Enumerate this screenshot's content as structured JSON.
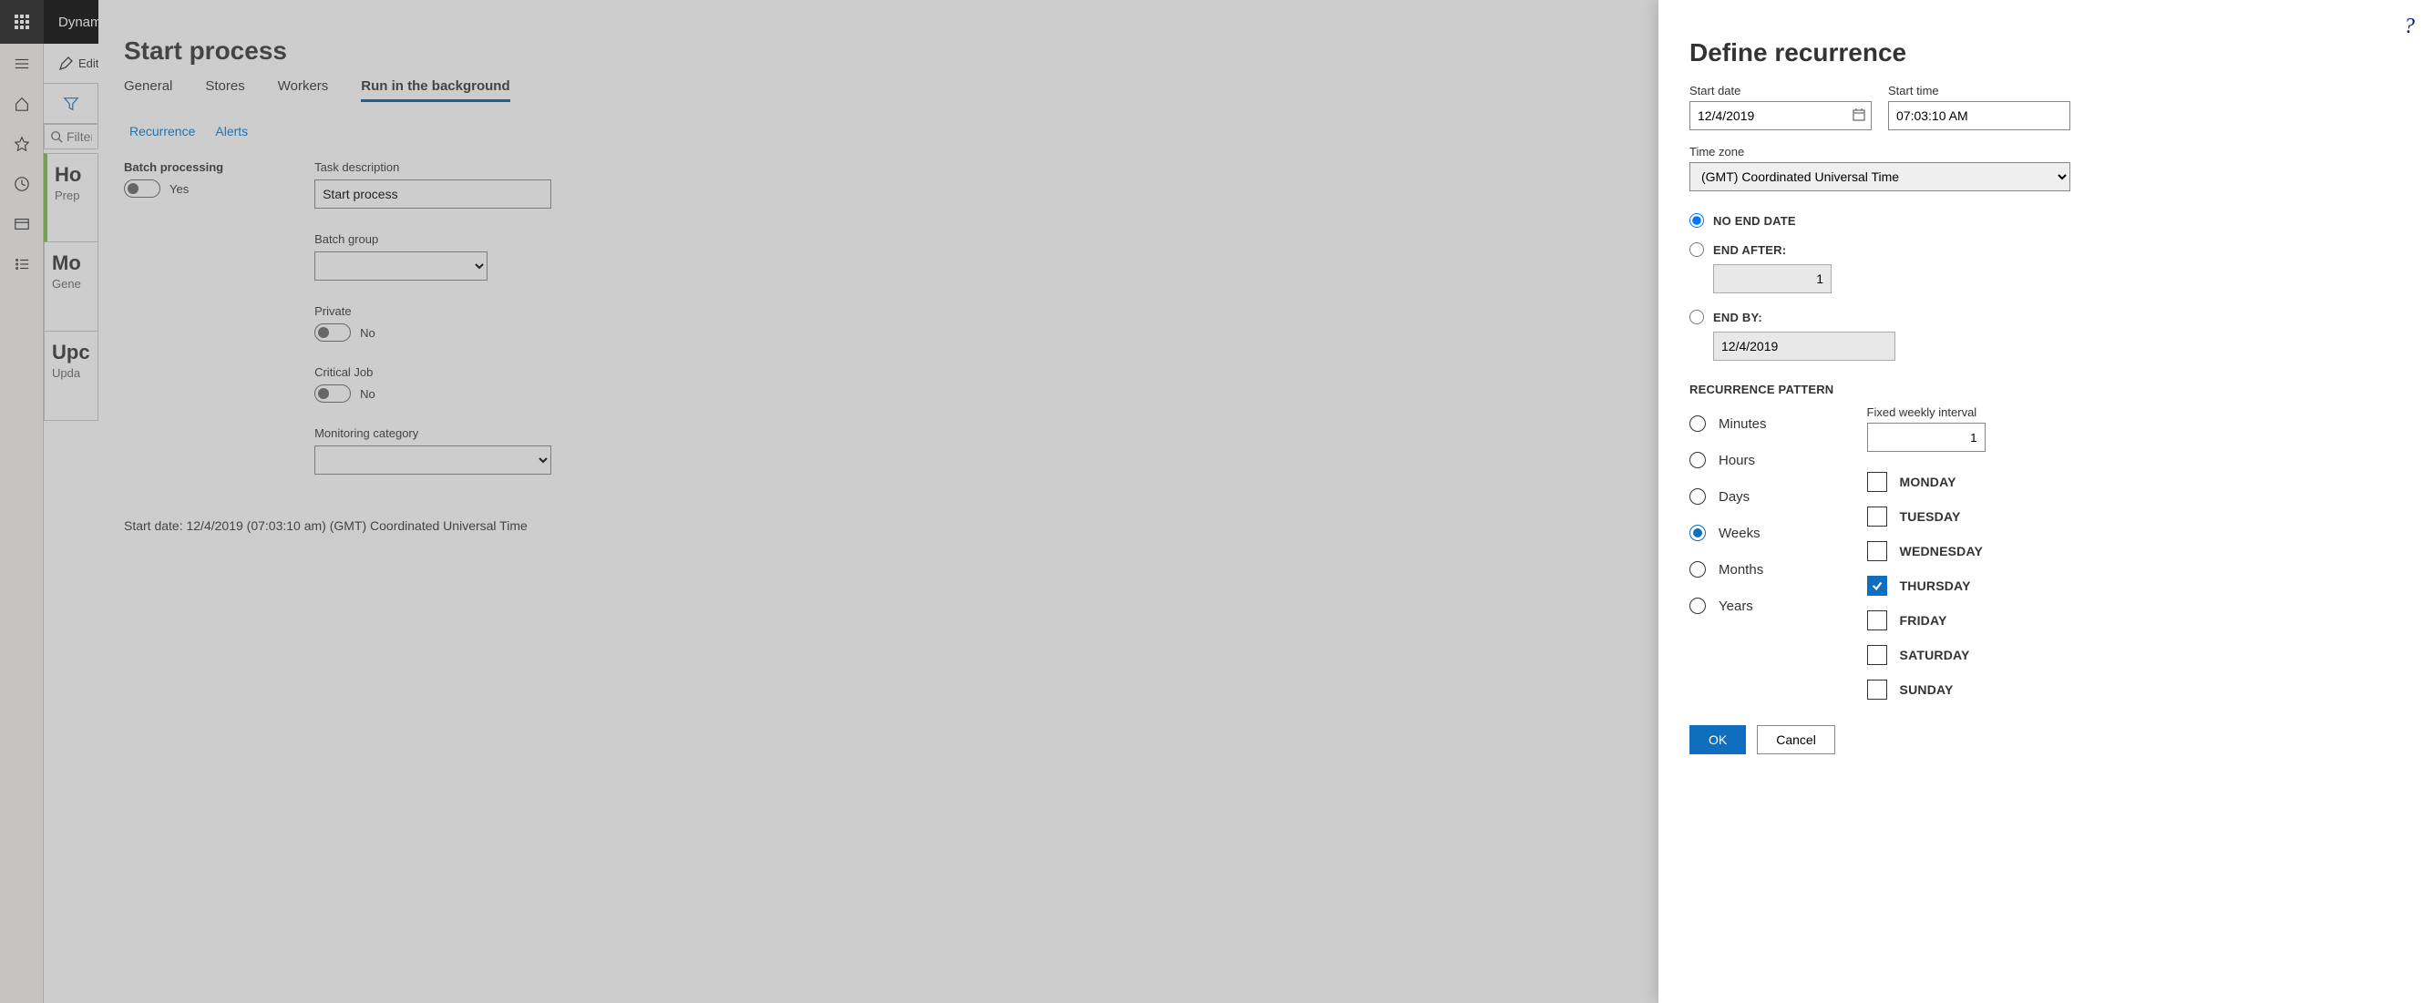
{
  "header": {
    "app_name": "Dynamics"
  },
  "toolbar": {
    "edit_label": "Edit"
  },
  "filter": {
    "placeholder": "Filter"
  },
  "tiles": [
    {
      "title": "Ho",
      "sub": "Prep"
    },
    {
      "title": "Mo",
      "sub": "Gene"
    },
    {
      "title": "Upc",
      "sub": "Upda"
    }
  ],
  "dialog": {
    "title": "Start process",
    "tabs": {
      "general": "General",
      "stores": "Stores",
      "workers": "Workers",
      "run_bg": "Run in the background"
    },
    "subtabs": {
      "recurrence": "Recurrence",
      "alerts": "Alerts"
    },
    "left_col": {
      "batch_processing_label": "Batch processing",
      "batch_processing_value": "Yes"
    },
    "right_col": {
      "task_desc_label": "Task description",
      "task_desc_value": "Start process",
      "batch_group_label": "Batch group",
      "private_label": "Private",
      "private_value": "No",
      "critical_label": "Critical Job",
      "critical_value": "No",
      "monitoring_label": "Monitoring category"
    },
    "start_note": "Start date: 12/4/2019 (07:03:10 am) (GMT) Coordinated Universal Time"
  },
  "recurrence": {
    "title": "Define recurrence",
    "start_date_label": "Start date",
    "start_date_value": "12/4/2019",
    "start_time_label": "Start time",
    "start_time_value": "07:03:10 AM",
    "tz_label": "Time zone",
    "tz_value": "(GMT) Coordinated Universal Time",
    "no_end_label": "No end date",
    "end_after_label": "End after:",
    "end_after_value": "1",
    "end_by_label": "End by:",
    "end_by_value": "12/4/2019",
    "pattern_header": "Recurrence pattern",
    "units": {
      "minutes": "Minutes",
      "hours": "Hours",
      "days": "Days",
      "weeks": "Weeks",
      "months": "Months",
      "years": "Years"
    },
    "interval_label": "Fixed weekly interval",
    "interval_value": "1",
    "days": {
      "monday": "Monday",
      "tuesday": "Tuesday",
      "wednesday": "Wednesday",
      "thursday": "Thursday",
      "friday": "Friday",
      "saturday": "Saturday",
      "sunday": "Sunday"
    },
    "ok_label": "OK",
    "cancel_label": "Cancel"
  }
}
